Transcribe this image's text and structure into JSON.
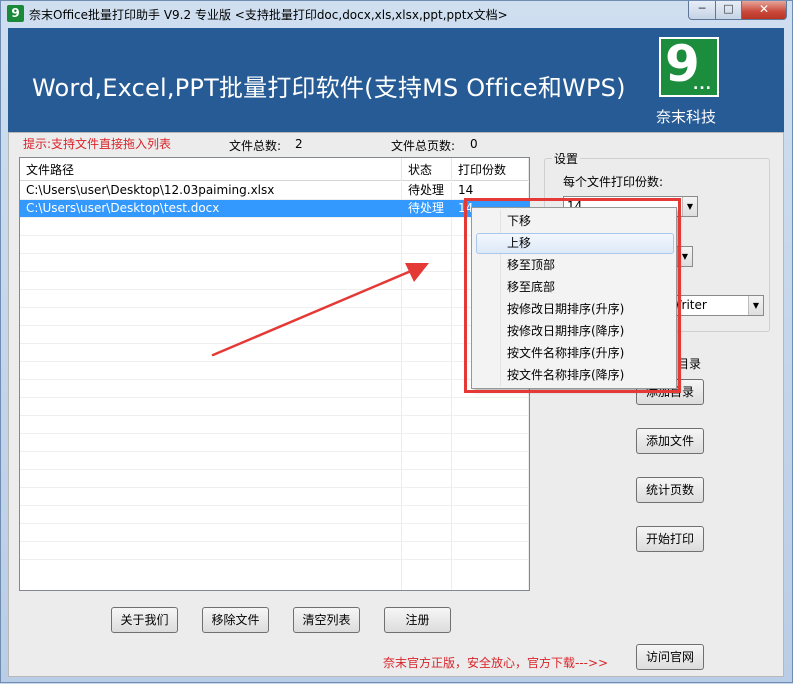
{
  "window": {
    "app_icon": "9",
    "title": "奈末Office批量打印助手 V9.2  专业版  <支持批量打印doc,docx,xls,xlsx,ppt,pptx文档>",
    "min_icon": "minimize-icon",
    "max_icon": "maximize-icon",
    "close_icon": "close-icon"
  },
  "banner": {
    "title": "Word,Excel,PPT批量打印软件(支持MS Office和WPS)",
    "logo_text": "9",
    "logo_dots": "...",
    "logo_caption": "奈末科技"
  },
  "hint": "提示:支持文件直接拖入列表",
  "stats": {
    "total_files_label": "文件总数:",
    "total_files": "2",
    "total_pages_label": "文件总页数:",
    "total_pages": "0"
  },
  "file_list": {
    "columns": [
      "文件路径",
      "状态",
      "打印份数"
    ],
    "rows": [
      {
        "path": "C:\\Users\\user\\Desktop\\12.03paiming.xlsx",
        "status": "待处理",
        "copies": "14"
      },
      {
        "path": "C:\\Users\\user\\Desktop\\test.docx",
        "status": "待处理",
        "copies": "14"
      }
    ],
    "selected_index": 1
  },
  "settings": {
    "legend": "设置",
    "copies_label": "每个文件打印份数:",
    "copies_value": "14",
    "printer_value": "ment Writer",
    "dir_label": "目录"
  },
  "side_buttons": {
    "add_dir": "添加目录",
    "add_file": "添加文件",
    "count_pages": "统计页数",
    "start_print": "开始打印",
    "visit_site": "访问官网"
  },
  "bottom_buttons": {
    "about": "关于我们",
    "remove": "移除文件",
    "clear": "清空列表",
    "register": "注册"
  },
  "footer_note": "奈末官方正版，安全放心，官方下载--->>",
  "context_menu": {
    "items": [
      "下移",
      "上移",
      "移至顶部",
      "移至底部",
      "按修改日期排序(升序)",
      "按修改日期排序(降序)",
      "按文件名称排序(升序)",
      "按文件名称排序(降序)"
    ],
    "hovered_index": 1
  },
  "colors": {
    "banner": "#275b95",
    "annotation": "#e53935",
    "selection": "#3399ff",
    "hint_text": "#d9252a"
  }
}
